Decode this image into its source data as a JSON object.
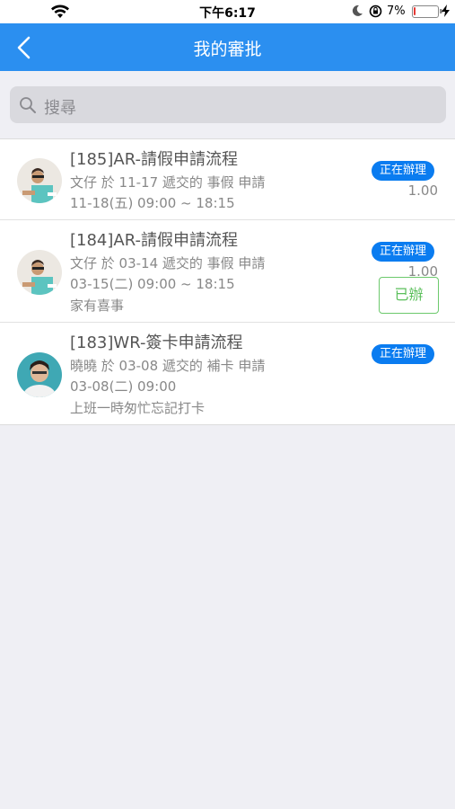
{
  "status_bar": {
    "time": "下午6:17",
    "battery_percent": "7%",
    "battery_level": 0.07,
    "battery_color": "#e53935"
  },
  "header": {
    "title": "我的審批",
    "back_icon": "chevron-left-icon",
    "color": "#2b8ff0"
  },
  "search": {
    "placeholder": "搜尋",
    "icon": "search-icon"
  },
  "items": [
    {
      "title": "[185]AR-請假申請流程",
      "line1": "文仔 於 11-17 遞交的 事假 申請",
      "line2": "11-18(五) 09:00 ~ 18:15",
      "badge": "正在辦理",
      "amount": "1.00"
    },
    {
      "title": "[184]AR-請假申請流程",
      "line1": "文仔 於 03-14 遞交的 事假 申請",
      "line2": "03-15(二) 09:00 ~ 18:15",
      "line3": "家有喜事",
      "badge": "正在辦理",
      "amount": "1.00",
      "action": "已辦"
    },
    {
      "title": "[183]WR-簽卡申請流程",
      "line1": "曉曉 於 03-08 遞交的 補卡 申請",
      "line2": "03-08(二) 09:00",
      "line3": "上班一時匆忙忘記打卡",
      "badge": "正在辦理"
    }
  ],
  "colors": {
    "badge": "#0a7cf0",
    "done_button": "#5bbf5b"
  }
}
